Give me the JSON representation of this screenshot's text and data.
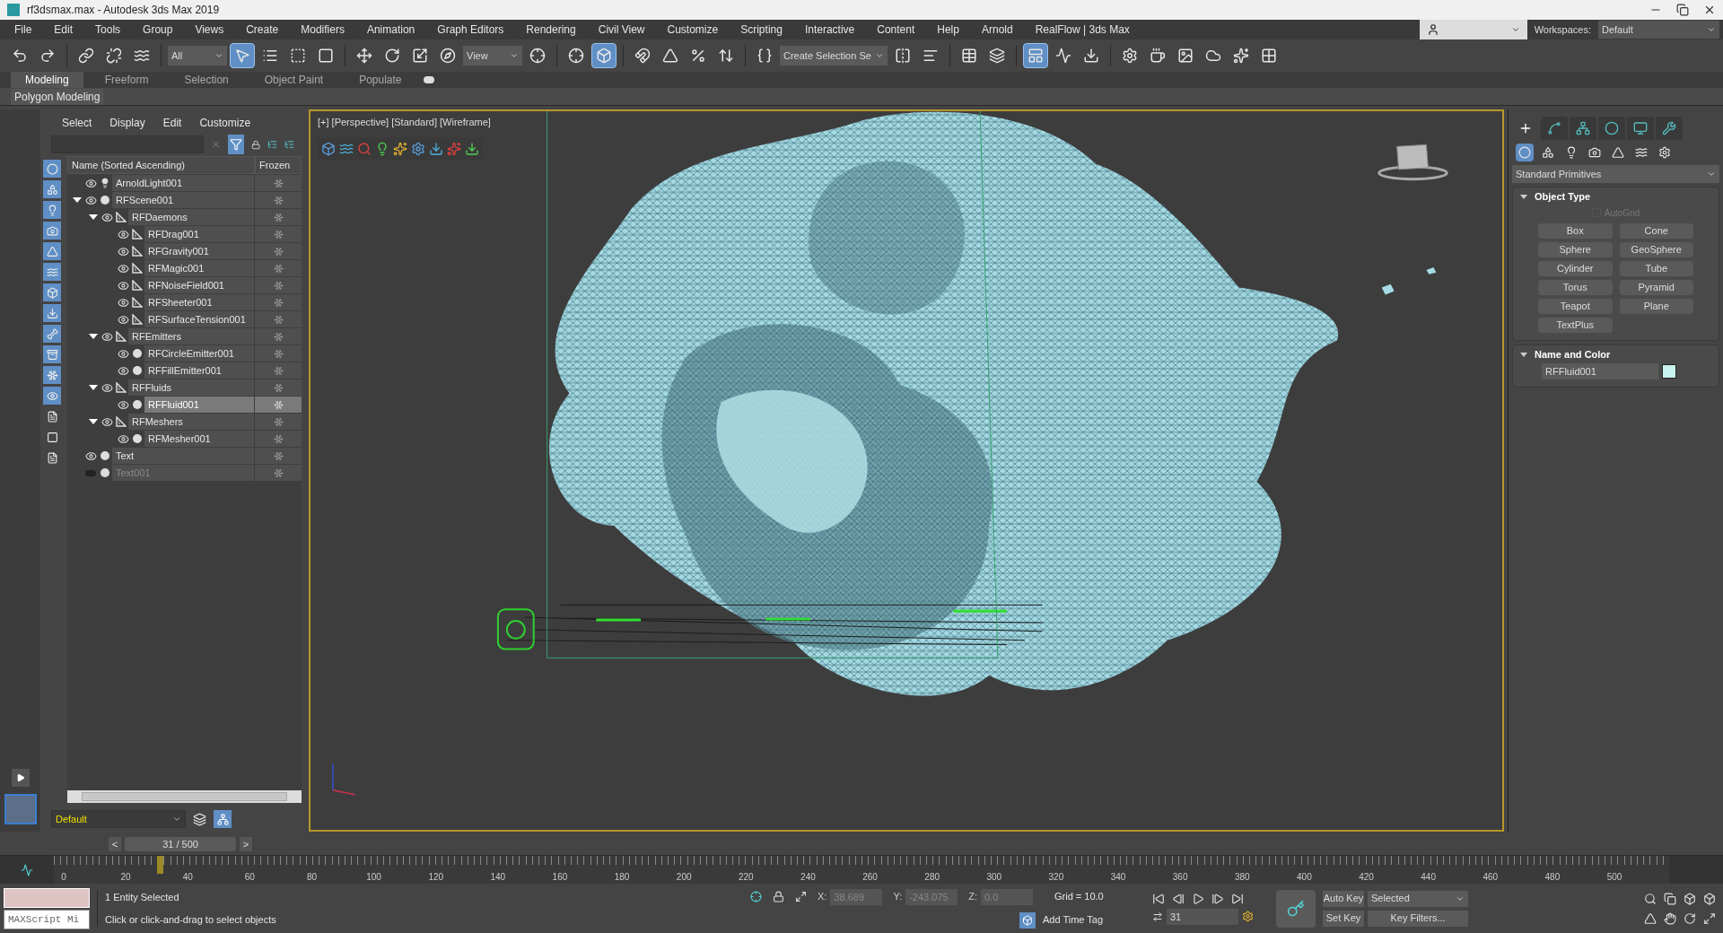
{
  "window": {
    "title": "rf3dsmax.max - Autodesk 3ds Max 2019"
  },
  "menu": [
    "File",
    "Edit",
    "Tools",
    "Group",
    "Views",
    "Create",
    "Modifiers",
    "Animation",
    "Graph Editors",
    "Rendering",
    "Civil View",
    "Customize",
    "Scripting",
    "Interactive",
    "Content",
    "Help",
    "Arnold",
    "RealFlow | 3ds Max"
  ],
  "workspaces": {
    "label": "Workspaces:",
    "value": "Default"
  },
  "toolbar": [
    {
      "kind": "icon",
      "selected": false
    },
    {
      "kind": "icon",
      "selected": false
    },
    {
      "kind": "sep"
    },
    {
      "kind": "icon",
      "selected": false
    },
    {
      "kind": "icon",
      "selected": false
    },
    {
      "kind": "icon",
      "selected": false
    },
    {
      "kind": "sep"
    },
    {
      "kind": "dropdown",
      "value": "All"
    },
    {
      "kind": "icon",
      "selected": true
    },
    {
      "kind": "icon",
      "selected": false
    },
    {
      "kind": "icon",
      "selected": false
    },
    {
      "kind": "icon",
      "selected": false
    },
    {
      "kind": "sep"
    },
    {
      "kind": "icon",
      "selected": false
    },
    {
      "kind": "icon",
      "selected": false
    },
    {
      "kind": "icon",
      "selected": false
    },
    {
      "kind": "icon",
      "selected": false
    },
    {
      "kind": "dropdown",
      "value": "View"
    },
    {
      "kind": "icon",
      "selected": false
    },
    {
      "kind": "sep"
    },
    {
      "kind": "icon",
      "selected": false
    },
    {
      "kind": "icon",
      "selected": true
    },
    {
      "kind": "sep"
    },
    {
      "kind": "icon",
      "selected": false
    },
    {
      "kind": "icon",
      "selected": false
    },
    {
      "kind": "icon",
      "selected": false
    },
    {
      "kind": "icon",
      "selected": false
    },
    {
      "kind": "sep"
    },
    {
      "kind": "icon",
      "selected": false
    },
    {
      "kind": "dropdown",
      "value": "Create Selection Se"
    },
    {
      "kind": "icon",
      "selected": false
    },
    {
      "kind": "icon",
      "selected": false
    },
    {
      "kind": "sep"
    },
    {
      "kind": "icon",
      "selected": false
    },
    {
      "kind": "icon",
      "selected": false
    },
    {
      "kind": "sep"
    },
    {
      "kind": "icon",
      "selected": true
    },
    {
      "kind": "icon",
      "selected": false
    },
    {
      "kind": "icon",
      "selected": false
    },
    {
      "kind": "sep"
    },
    {
      "kind": "icon",
      "selected": false
    },
    {
      "kind": "icon",
      "selected": false
    },
    {
      "kind": "icon",
      "selected": false
    },
    {
      "kind": "icon",
      "selected": false
    },
    {
      "kind": "icon",
      "selected": false
    },
    {
      "kind": "icon",
      "selected": false
    }
  ],
  "ribbon": {
    "tabs": [
      {
        "label": "Modeling",
        "selected": true
      },
      {
        "label": "Freeform",
        "selected": false
      },
      {
        "label": "Selection",
        "selected": false
      },
      {
        "label": "Object Paint",
        "selected": false
      },
      {
        "label": "Populate",
        "selected": false
      }
    ],
    "panel": "Polygon Modeling"
  },
  "explorer": {
    "menu": [
      "Select",
      "Display",
      "Edit",
      "Customize"
    ],
    "filters": [
      {
        "on": true
      },
      {
        "on": true
      },
      {
        "on": true
      },
      {
        "on": true
      },
      {
        "on": true
      },
      {
        "on": true
      },
      {
        "on": true
      },
      {
        "on": true
      },
      {
        "on": true
      },
      {
        "on": true
      },
      {
        "on": true
      },
      {
        "on": true
      },
      {
        "on": false
      },
      {
        "on": false
      },
      {
        "on": false
      }
    ],
    "columns": [
      "Name (Sorted Ascending)",
      "Frozen"
    ],
    "tree": [
      {
        "name": "ArnoldLight001",
        "kind": "light",
        "visible": true,
        "selected": false
      },
      {
        "name": "RFScene001",
        "kind": "object",
        "visible": true,
        "selected": false,
        "expanded": true,
        "children": [
          {
            "name": "RFDaemons",
            "kind": "helper",
            "visible": true,
            "selected": false,
            "expanded": true,
            "children": [
              {
                "name": "RFDrag001",
                "kind": "helper",
                "visible": true,
                "selected": false
              },
              {
                "name": "RFGravity001",
                "kind": "helper",
                "visible": true,
                "selected": false
              },
              {
                "name": "RFMagic001",
                "kind": "helper",
                "visible": true,
                "selected": false
              },
              {
                "name": "RFNoiseField001",
                "kind": "helper",
                "visible": true,
                "selected": false
              },
              {
                "name": "RFSheeter001",
                "kind": "helper",
                "visible": true,
                "selected": false
              },
              {
                "name": "RFSurfaceTension001",
                "kind": "helper",
                "visible": true,
                "selected": false
              }
            ]
          },
          {
            "name": "RFEmitters",
            "kind": "helper",
            "visible": true,
            "selected": false,
            "expanded": true,
            "children": [
              {
                "name": "RFCircleEmitter001",
                "kind": "object",
                "visible": true,
                "selected": false
              },
              {
                "name": "RFFillEmitter001",
                "kind": "object",
                "visible": true,
                "selected": false
              }
            ]
          },
          {
            "name": "RFFluids",
            "kind": "helper",
            "visible": true,
            "selected": false,
            "expanded": true,
            "children": [
              {
                "name": "RFFluid001",
                "kind": "object",
                "visible": true,
                "selected": true
              }
            ]
          },
          {
            "name": "RFMeshers",
            "kind": "helper",
            "visible": true,
            "selected": false,
            "expanded": true,
            "children": [
              {
                "name": "RFMesher001",
                "kind": "object",
                "visible": true,
                "selected": false
              }
            ]
          }
        ]
      },
      {
        "name": "Text",
        "kind": "object",
        "visible": true,
        "selected": false
      },
      {
        "name": "Text001",
        "kind": "object",
        "visible": false,
        "selected": false
      }
    ],
    "layer": "Default"
  },
  "viewport": {
    "label": "[+] [Perspective] [Standard] [Wireframe]"
  },
  "command_panel": {
    "tabs": [
      {
        "selected": true
      },
      {
        "selected": false
      },
      {
        "selected": false
      },
      {
        "selected": false
      },
      {
        "selected": false
      },
      {
        "selected": false
      }
    ],
    "categories": [
      {
        "selected": true
      },
      {
        "selected": false
      },
      {
        "selected": false
      },
      {
        "selected": false
      },
      {
        "selected": false
      },
      {
        "selected": false
      },
      {
        "selected": false
      }
    ],
    "dropdown": "Standard Primitives",
    "object_type": {
      "title": "Object Type",
      "expanded": true,
      "autogrid": {
        "label": "AutoGrid",
        "checked": false,
        "disabled": true
      },
      "buttons": [
        "Box",
        "Cone",
        "Sphere",
        "GeoSphere",
        "Cylinder",
        "Tube",
        "Torus",
        "Pyramid",
        "Teapot",
        "Plane",
        "TextPlus"
      ]
    },
    "name_and_color": {
      "title": "Name and Color",
      "expanded": true,
      "name": "RFFluid001",
      "color": "#c9f2ef"
    }
  },
  "time_slider": {
    "prev": "<",
    "reading": "31 / 500",
    "next": ">",
    "level": 0.062
  },
  "timeline": {
    "ticks": [
      "0",
      "20",
      "40",
      "60",
      "80",
      "100",
      "120",
      "140",
      "160",
      "180",
      "200",
      "220",
      "240",
      "260",
      "280",
      "300",
      "320",
      "340",
      "360",
      "380",
      "400",
      "420",
      "440",
      "460",
      "480",
      "500"
    ],
    "level": 0.062
  },
  "status": {
    "maxscript": "MAXScript Mi",
    "selection": "1 Entity Selected",
    "prompt": "Click or click-and-drag to select objects",
    "x": {
      "label": "X:",
      "value": "38.689"
    },
    "y": {
      "label": "Y:",
      "value": "-243.075"
    },
    "z": {
      "label": "Z:",
      "value": "0.0"
    },
    "grid": "Grid = 10.0",
    "time_tag": "Add Time Tag",
    "frame": "31",
    "auto_key": "Auto Key",
    "set_key": "Set Key",
    "key_mode": "Selected",
    "key_filters": "Key Filters..."
  }
}
